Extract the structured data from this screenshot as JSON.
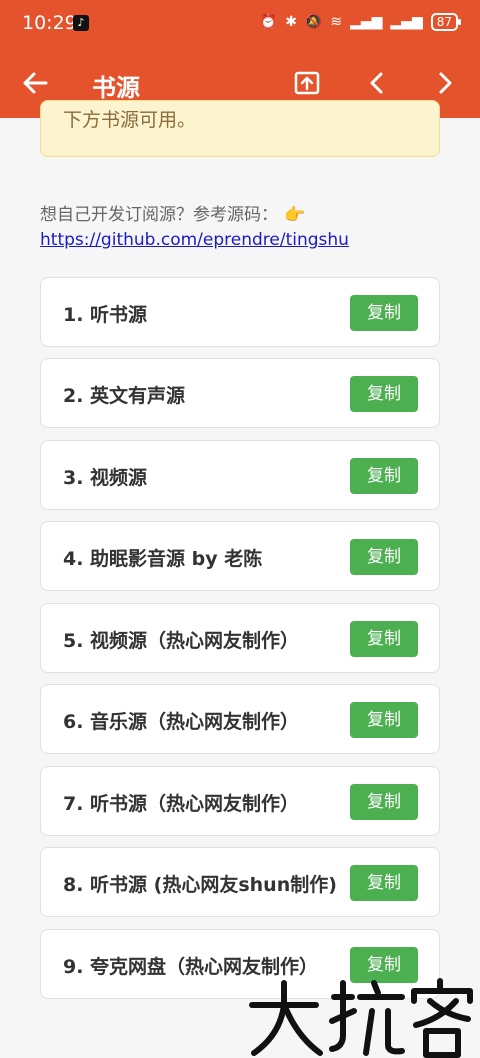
{
  "status_bar": {
    "time": "10:29",
    "battery": "87"
  },
  "app_bar": {
    "title": "书源"
  },
  "notice": {
    "text": "下方书源可用。"
  },
  "dev": {
    "note": "想自己开发订阅源？参考源码：",
    "emoji": "👉",
    "link": "https://github.com/eprendre/tingshu"
  },
  "sources": [
    {
      "label": "1. 听书源",
      "button": "复制"
    },
    {
      "label": "2. 英文有声源",
      "button": "复制"
    },
    {
      "label": "3. 视频源",
      "button": "复制"
    },
    {
      "label": "4. 助眠影音源 by 老陈",
      "button": "复制"
    },
    {
      "label": "5. 视频源（热心网友制作）",
      "button": "复制"
    },
    {
      "label": "6. 音乐源（热心网友制作）",
      "button": "复制"
    },
    {
      "label": "7. 听书源（热心网友制作）",
      "button": "复制"
    },
    {
      "label": "8. 听书源 (热心网友shun制作)",
      "button": "复制"
    },
    {
      "label": "9. 夸克网盘（热心网友制作）",
      "button": "复制"
    }
  ],
  "colors": {
    "primary": "#e4532c",
    "button": "#4caf50",
    "notice_bg": "#fcf3cf"
  }
}
